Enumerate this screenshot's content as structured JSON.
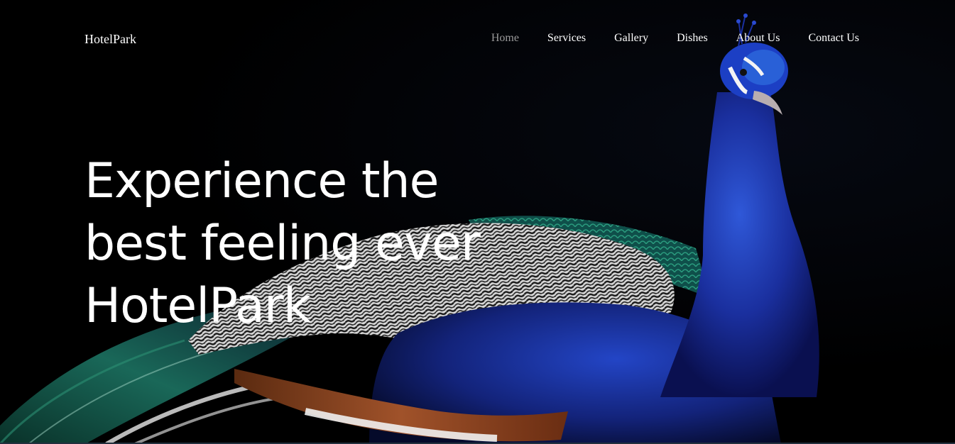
{
  "brand": "HotelPark",
  "nav": {
    "items": [
      {
        "label": "Home",
        "active": true
      },
      {
        "label": "Services",
        "active": false
      },
      {
        "label": "Gallery",
        "active": false
      },
      {
        "label": "Dishes",
        "active": false
      },
      {
        "label": "About Us",
        "active": false
      },
      {
        "label": "Contact Us",
        "active": false
      }
    ]
  },
  "hero": {
    "headline_lines": [
      "Experience the",
      "best feeling ever",
      "HotelPark"
    ],
    "image_subject": "peacock"
  },
  "colors": {
    "background": "#000000",
    "text": "#ffffff",
    "nav_active": "#9a9a9a",
    "peacock_blue": "#1f3fb0",
    "peacock_green": "#1d7a63"
  }
}
